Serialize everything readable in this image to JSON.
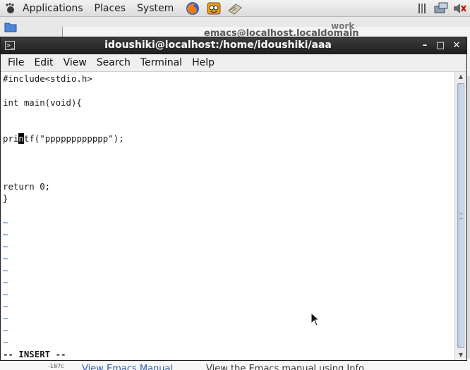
{
  "top_panel": {
    "menus": [
      "Applications",
      "Places",
      "System"
    ],
    "launchers": [
      "firefox-icon",
      "mail-icon",
      "notes-icon"
    ],
    "tray": [
      "updates-icon",
      "network-icon",
      "volume-muted-icon"
    ]
  },
  "background_window": {
    "title": "emacs@localhost.localdomain",
    "partial_label": "work",
    "link_text": "View Emacs Manual",
    "desc_text": "View the Emacs manual using Info",
    "side_num": "-187c"
  },
  "terminal": {
    "title": "idoushiki@localhost:/home/idoushiki/aaa",
    "menu": [
      "File",
      "Edit",
      "View",
      "Search",
      "Terminal",
      "Help"
    ],
    "code_lines": {
      "l1": "#include<stdio.h>",
      "l2": "int main(void){",
      "l3_before": "pri",
      "l3_cursor": "n",
      "l3_after": "tf(\"pppppppppppp\");",
      "l4": "return 0;",
      "l5": "}"
    },
    "tilde": "~",
    "status": "-- INSERT --"
  },
  "colors": {
    "tilde": "#3b6fd3",
    "titlebar": "#2a2a2a"
  }
}
